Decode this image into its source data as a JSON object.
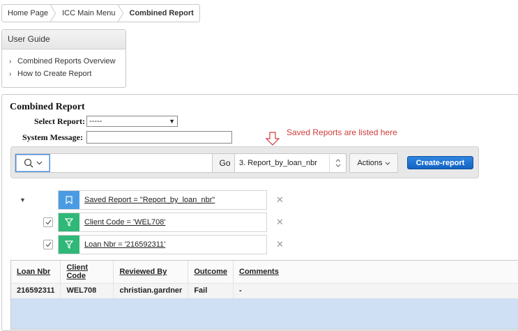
{
  "breadcrumb": [
    "Home Page",
    "ICC Main Menu",
    "Combined Report"
  ],
  "guide": {
    "title": "User Guide",
    "items": [
      "Combined Reports Overview",
      "How to Create Report"
    ]
  },
  "report": {
    "title": "Combined Report",
    "select_label": "Select Report:",
    "select_value": "-----",
    "sysmsg_label": "System Message:",
    "sysmsg_value": "",
    "annotation": "Saved Reports are listed here"
  },
  "toolbar": {
    "search_value": "",
    "go_label": "Go",
    "saved_report_value": "3. Report_by_loan_nbr",
    "actions_label": "Actions",
    "create_label": "Create-report"
  },
  "filters": [
    {
      "type": "saved",
      "text": "Saved Report = \"Report_by_loan_nbr\"",
      "checked": null
    },
    {
      "type": "filter",
      "text": "Client Code = 'WEL708'",
      "checked": true
    },
    {
      "type": "filter",
      "text": "Loan Nbr = '216592311'",
      "checked": true
    }
  ],
  "table": {
    "columns": [
      "Loan Nbr",
      "Client Code",
      "Reviewed By",
      "Outcome",
      "Comments"
    ],
    "rows": [
      [
        "216592311",
        "WEL708",
        "christian.gardner",
        "Fail",
        "-"
      ]
    ]
  },
  "colors": {
    "accent": "#1463c3",
    "annotation": "#d03b3b",
    "saved_icon": "#4a9be3",
    "filter_icon": "#2fb877"
  }
}
